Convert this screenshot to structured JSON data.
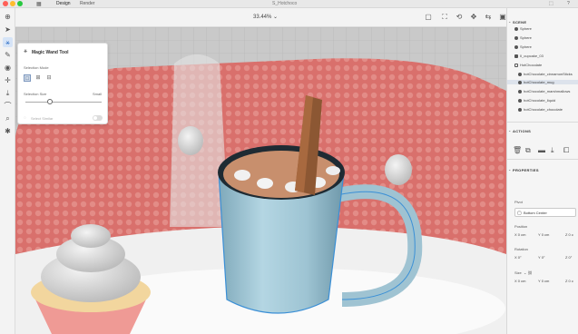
{
  "topbar": {
    "tabs": [
      "Design",
      "Render"
    ],
    "doc_title": "S_Hotchoco"
  },
  "toolbar": {
    "zoom": "33.44%"
  },
  "wand_popup": {
    "title": "Magic Wand Tool",
    "selection_mode_label": "Selection Mode",
    "selection_size_label": "Selection Size",
    "selection_size_value": "Small",
    "select_similar_label": "Select Similar"
  },
  "scene": {
    "header": "SCENE",
    "items": [
      {
        "label": "Sphere",
        "indent": false
      },
      {
        "label": "Sphere",
        "indent": false
      },
      {
        "label": "Sphere",
        "indent": false
      },
      {
        "label": "Il_cupcake_03",
        "indent": false
      },
      {
        "label": "HotChocolate",
        "indent": false
      },
      {
        "label": "hotChocolate_cinnamonSticks",
        "indent": true
      },
      {
        "label": "hotChocolate_mug",
        "indent": true,
        "selected": true
      },
      {
        "label": "hotChocolate_marshmallows",
        "indent": true
      },
      {
        "label": "hotChocolate_liquid",
        "indent": true
      },
      {
        "label": "hotChocolate_chocolate",
        "indent": true
      }
    ]
  },
  "actions": {
    "header": "ACTIONS"
  },
  "properties": {
    "header": "PROPERTIES",
    "pivot_label": "Pivot",
    "pivot_value": "Bottom Center",
    "position_label": "Position",
    "position": {
      "x": "X  0 cm",
      "y": "Y  0 cm",
      "z": "Z  0 c"
    },
    "rotation_label": "Rotation",
    "rotation": {
      "x": "X  0°",
      "y": "Y  0°",
      "z": "Z  0°"
    },
    "size_label": "Size",
    "size": {
      "x": "X  0 cm",
      "y": "Y  0 cm",
      "z": "Z  0 c"
    }
  },
  "colors": {
    "accent": "#2b6cc4",
    "backdrop_red": "#d9706c",
    "mug_blue": "#a8ccd9",
    "selection_outline": "#3a8fd6"
  }
}
